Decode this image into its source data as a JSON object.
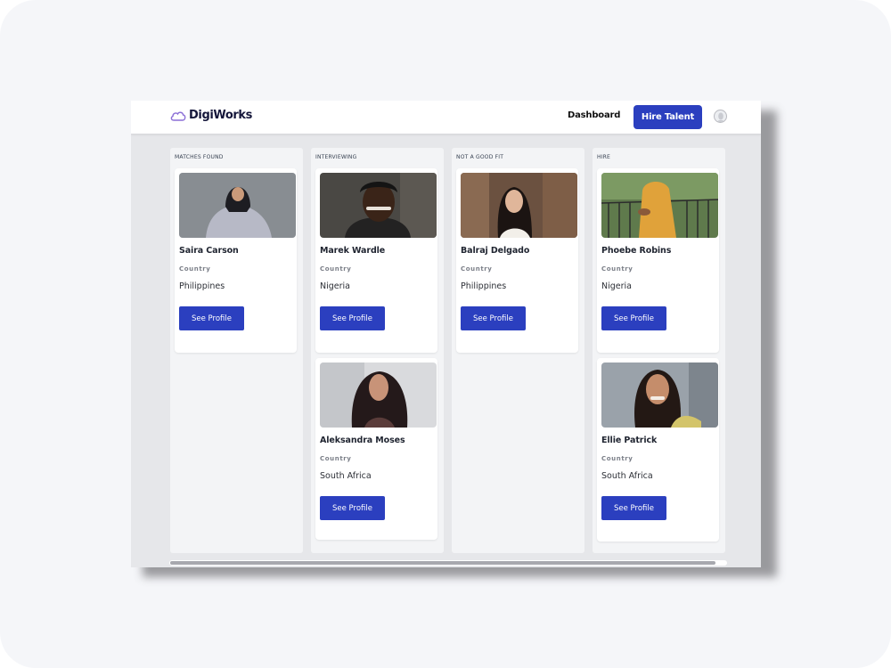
{
  "app": {
    "brand": "DigiWorks",
    "nav": {
      "dashboard_label": "Dashboard",
      "hire_button_label": "Hire Talent"
    }
  },
  "labels": {
    "country": "Country",
    "see_profile": "See Profile"
  },
  "columns": [
    {
      "title": "MATCHES FOUND",
      "cards": [
        {
          "name": "Saira Carson",
          "country": "Philippines"
        }
      ]
    },
    {
      "title": "INTERVIEWING",
      "cards": [
        {
          "name": "Marek Wardle",
          "country": "Nigeria"
        },
        {
          "name": "Aleksandra Moses",
          "country": "South Africa"
        }
      ]
    },
    {
      "title": "NOT A GOOD FIT",
      "cards": [
        {
          "name": "Balraj Delgado",
          "country": "Philippines"
        }
      ]
    },
    {
      "title": "HIRE",
      "cards": [
        {
          "name": "Phoebe Robins",
          "country": "Nigeria"
        },
        {
          "name": "Ellie Patrick",
          "country": "South Africa"
        }
      ]
    }
  ],
  "colors": {
    "primary": "#2b3fbf",
    "board_bg": "#e6e7ea",
    "column_bg": "#f3f4f6",
    "brand_text": "#14163a",
    "logo_accent": "#8b6fd6"
  }
}
